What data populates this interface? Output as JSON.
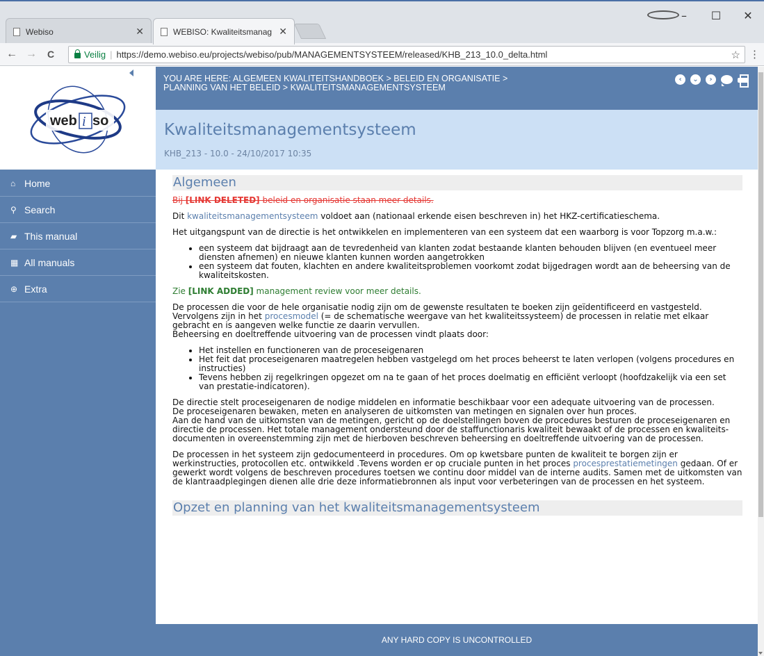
{
  "browser": {
    "tabs": [
      {
        "title": "Webiso",
        "close": "✕"
      },
      {
        "title": "WEBISO: Kwaliteitsmanag",
        "close": "✕"
      }
    ],
    "window_controls": {
      "minimize": "–",
      "maximize": "☐",
      "close": "✕"
    },
    "nav": {
      "back": "←",
      "forward": "→",
      "reload": "C"
    },
    "address": {
      "secure_label": "Veilig",
      "separator": "|",
      "url": "https://demo.webiso.eu/projects/webiso/pub/MANAGEMENTSYSTEEM/released/KHB_213_10.0_delta.html"
    },
    "star": "☆",
    "menu": "⋮"
  },
  "sidebar": {
    "logo_text_a": "web",
    "logo_text_b": "i",
    "logo_text_c": "so",
    "items": [
      {
        "label": "Home",
        "icon": "⌂"
      },
      {
        "label": "Search",
        "icon": "⚲"
      },
      {
        "label": "This manual",
        "icon": "▰"
      },
      {
        "label": "All manuals",
        "icon": "▦"
      },
      {
        "label": "Extra",
        "icon": "⊕"
      }
    ]
  },
  "header": {
    "breadcrumb": "YOU ARE HERE: ALGEMEEN KWALITEITSHANDBOEK > BELEID EN ORGANISATIE > PLANNING VAN HET BELEID > KWALITEITSMANAGEMENTSYSTEEM",
    "icons": {
      "prev": "‹",
      "down": "⌄",
      "next": "›"
    },
    "title": "Kwaliteitsmanagementsysteem",
    "meta": "KHB_213 - 10.0 - 24/10/2017 10:35"
  },
  "content": {
    "section1": "Algemeen",
    "deleted_pre": "Bij ",
    "deleted_link": "[LINK DELETED]",
    "deleted_post": " beleid en organisatie staan meer details.",
    "p1_pre": "Dit ",
    "p1_link": "kwaliteitsmanagementsysteem",
    "p1_post": " voldoet aan (nationaal erkende eisen beschreven in) het HKZ-certificatieschema.",
    "p2": "Het uitgangspunt van de directie is het ontwikkelen en implementeren van een systeem dat een waarborg is voor Topzorg m.a.w.:",
    "list1": [
      "een systeem dat bijdraagt aan de tevredenheid van klanten zodat bestaande klanten behouden blijven (en eventueel meer diensten afnemen) en nieuwe klanten kunnen worden aangetrokken",
      "een systeem dat fouten, klachten en andere kwaliteitsproblemen voorkomt zodat bijgedragen wordt aan de beheersing van de kwaliteitskosten."
    ],
    "added_pre": "Zie ",
    "added_link": "[LINK ADDED]",
    "added_post": " management review voor meer details.",
    "p3_a": "De processen die voor de hele organisatie nodig zijn om de gewenste resultaten te boeken zijn geïdentificeerd en vastgesteld.",
    "p3_b_pre": "Vervolgens zijn in het ",
    "p3_b_link": "procesmodel",
    "p3_b_post": " (= de schematische weergave van het kwaliteitssysteem) de processen in relatie met elkaar gebracht en is aangeven welke functie ze daarin vervullen.",
    "p3_c": "Beheersing en doeltreffende uitvoering van de processen vindt plaats door:",
    "list2": [
      "Het instellen en functioneren van de proceseigenaren",
      "Het feit dat proceseigenaren maatregelen hebben vastgelegd om het proces beheerst te laten verlopen (volgens procedures en instructies)",
      "Tevens hebben zij regelkringen opgezet om na te gaan of het proces doelmatig en efficiënt verloopt (hoofdzakelijk via een set van prestatie-indicatoren)."
    ],
    "p4_a": "De directie stelt proceseigenaren de nodige middelen en informatie beschikbaar voor een adequate uitvoering van de processen.",
    "p4_b": "De proceseigenaren bewaken, meten en analyseren de uitkomsten van metingen en signalen over hun proces.",
    "p4_c": "Aan de hand van de uitkomsten van de metingen, gericht op de doelstellingen boven de procedures besturen de proceseigenaren en directie de processen. Het totale management ondersteund door de staffunctionaris kwaliteit bewaakt of de processen en kwaliteits-documenten in overeenstemming zijn met de hierboven beschreven beheersing en doeltreffende uitvoering van de processen.",
    "p5_pre": "De processen in het systeem zijn gedocumenteerd in procedures. Om op kwetsbare punten de kwaliteit te borgen zijn er werkinstructies, protocollen etc. ontwikkeld .Tevens worden er op cruciale punten in het proces ",
    "p5_link": "procesprestatiemetingen",
    "p5_post": " gedaan. Of er gewerkt wordt volgens de beschreven procedures toetsen we continu door middel van de interne audits. Samen met de uitkomsten van de klantraadplegingen dienen alle drie deze informatiebronnen als input voor verbeteringen van de processen en het systeem.",
    "section2": "Opzet en planning van het kwaliteitsmanagementsysteem"
  },
  "footer": "ANY HARD COPY IS UNCONTROLLED"
}
